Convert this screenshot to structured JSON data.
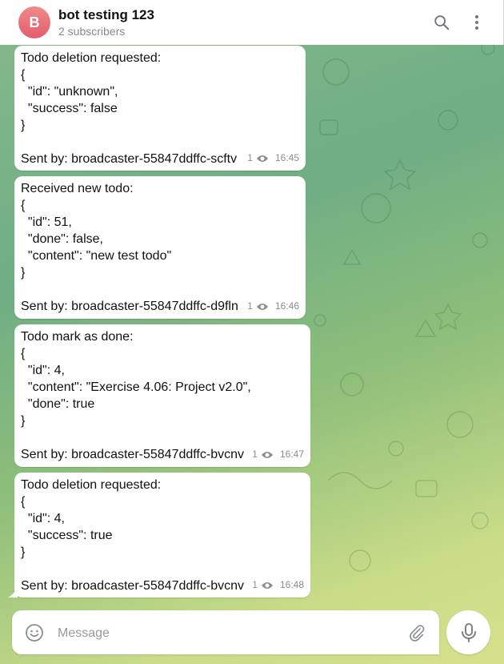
{
  "header": {
    "avatar_letter": "B",
    "title": "bot testing 123",
    "subtitle": "2 subscribers",
    "search_icon": "search-icon",
    "more_icon": "more-vertical-icon"
  },
  "messages": [
    {
      "lines": [
        "Todo deletion requested:",
        "{",
        "  \"id\": \"unknown\",",
        "  \"success\": false",
        "}"
      ],
      "sender": "Sent by: broadcaster-55847ddffc-scftv",
      "views": "1",
      "time": "16:45"
    },
    {
      "lines": [
        "Received new todo:",
        "{",
        "  \"id\": 51,",
        "  \"done\": false,",
        "  \"content\": \"new test todo\"",
        "}"
      ],
      "sender": "Sent by: broadcaster-55847ddffc-d9fln",
      "views": "1",
      "time": "16:46"
    },
    {
      "lines": [
        "Todo mark as done:",
        "{",
        "  \"id\": 4,",
        "  \"content\": \"Exercise 4.06: Project v2.0\",",
        "  \"done\": true",
        "}"
      ],
      "sender": "Sent by: broadcaster-55847ddffc-bvcnv",
      "views": "1",
      "time": "16:47"
    },
    {
      "lines": [
        "Todo deletion requested:",
        "{",
        "  \"id\": 4,",
        "  \"success\": true",
        "}"
      ],
      "sender": "Sent by: broadcaster-55847ddffc-bvcnv",
      "views": "1",
      "time": "16:48"
    }
  ],
  "composer": {
    "placeholder": "Message",
    "emoji_icon": "smile-icon",
    "attach_icon": "paperclip-icon",
    "mic_icon": "microphone-icon"
  },
  "colors": {
    "bubble": "#ffffff",
    "meta": "#8a8f8a",
    "avatar": "#e35d6d"
  }
}
